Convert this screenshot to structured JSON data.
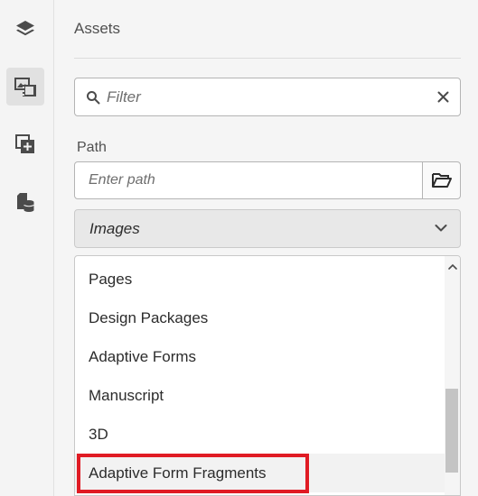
{
  "rail": {
    "items": [
      {
        "icon": "layers-icon"
      },
      {
        "icon": "assets-icon",
        "active": true
      },
      {
        "icon": "add-component-icon"
      },
      {
        "icon": "content-tree-icon"
      }
    ]
  },
  "panel": {
    "title": "Assets",
    "filter_placeholder": "Filter",
    "path_label": "Path",
    "path_placeholder": "Enter path",
    "selected_type": "Images",
    "options": [
      {
        "label": "Pages"
      },
      {
        "label": "Design Packages"
      },
      {
        "label": "Adaptive Forms"
      },
      {
        "label": "Manuscript"
      },
      {
        "label": "3D"
      },
      {
        "label": "Adaptive Form Fragments",
        "hovered": true,
        "annotated": true
      }
    ]
  },
  "colors": {
    "annotation": "#e01b24",
    "rail_bg": "#f4f4f4",
    "panel_bg": "#f5f5f5"
  }
}
